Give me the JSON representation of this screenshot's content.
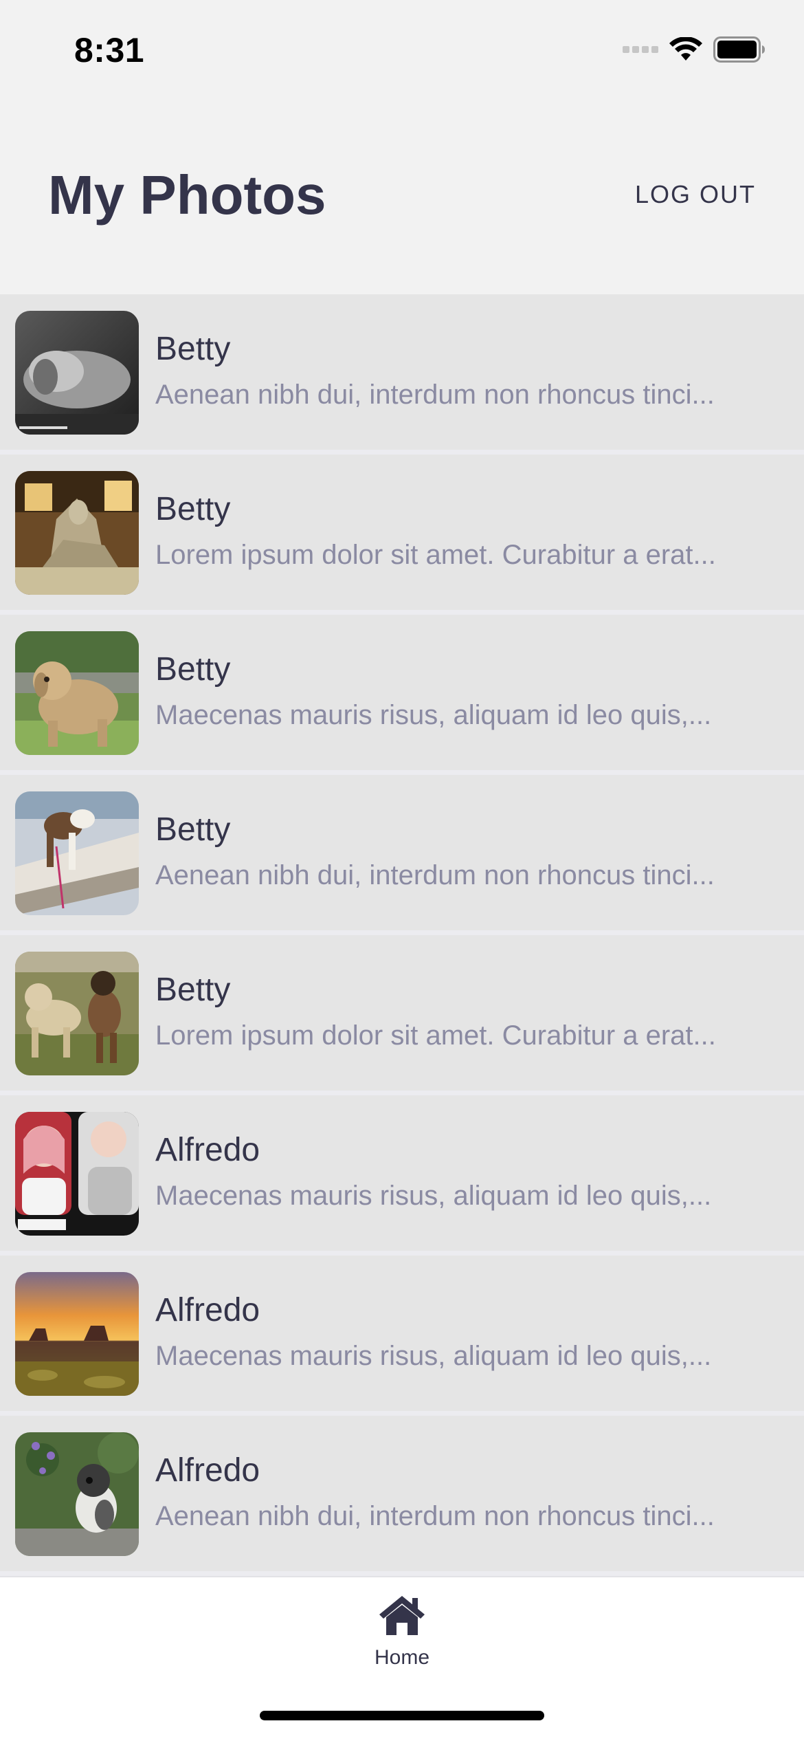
{
  "status_bar": {
    "time": "8:31",
    "icons": [
      "cellular-signal-icon",
      "wifi-icon",
      "battery-icon"
    ]
  },
  "header": {
    "title": "My Photos",
    "logout_label": "LOG OUT"
  },
  "photos": [
    {
      "title": "Betty",
      "description": "Aenean nibh dui, interdum non rhoncus tinci...",
      "thumbnail": "sleeping-dog-bw"
    },
    {
      "title": "Betty",
      "description": "Lorem ipsum dolor sit amet. Curabitur a erat...",
      "thumbnail": "museum-sculpture"
    },
    {
      "title": "Betty",
      "description": "Maecenas mauris risus, aliquam id leo quis,...",
      "thumbnail": "curly-dog-on-grass"
    },
    {
      "title": "Betty",
      "description": "Aenean nibh dui, interdum non rhoncus tinci...",
      "thumbnail": "beagle-on-logs"
    },
    {
      "title": "Betty",
      "description": "Lorem ipsum dolor sit amet. Curabitur a erat...",
      "thumbnail": "dogs-playing"
    },
    {
      "title": "Alfredo",
      "description": "Maecenas mauris risus, aliquam id leo quis,...",
      "thumbnail": "cartoon-girls"
    },
    {
      "title": "Alfredo",
      "description": "Maecenas mauris risus, aliquam id leo quis,...",
      "thumbnail": "desert-sunset"
    },
    {
      "title": "Alfredo",
      "description": "Aenean nibh dui, interdum non rhoncus tinci...",
      "thumbnail": "dog-in-garden"
    }
  ],
  "tab_bar": {
    "items": [
      {
        "label": "Home",
        "icon": "home-icon",
        "active": true
      }
    ]
  },
  "colors": {
    "title_text": "#34344a",
    "description_text": "#8a8aa2",
    "header_bg": "#f2f2f2",
    "row_bg": "#e5e5e5",
    "tab_bar_bg": "#ffffff"
  }
}
